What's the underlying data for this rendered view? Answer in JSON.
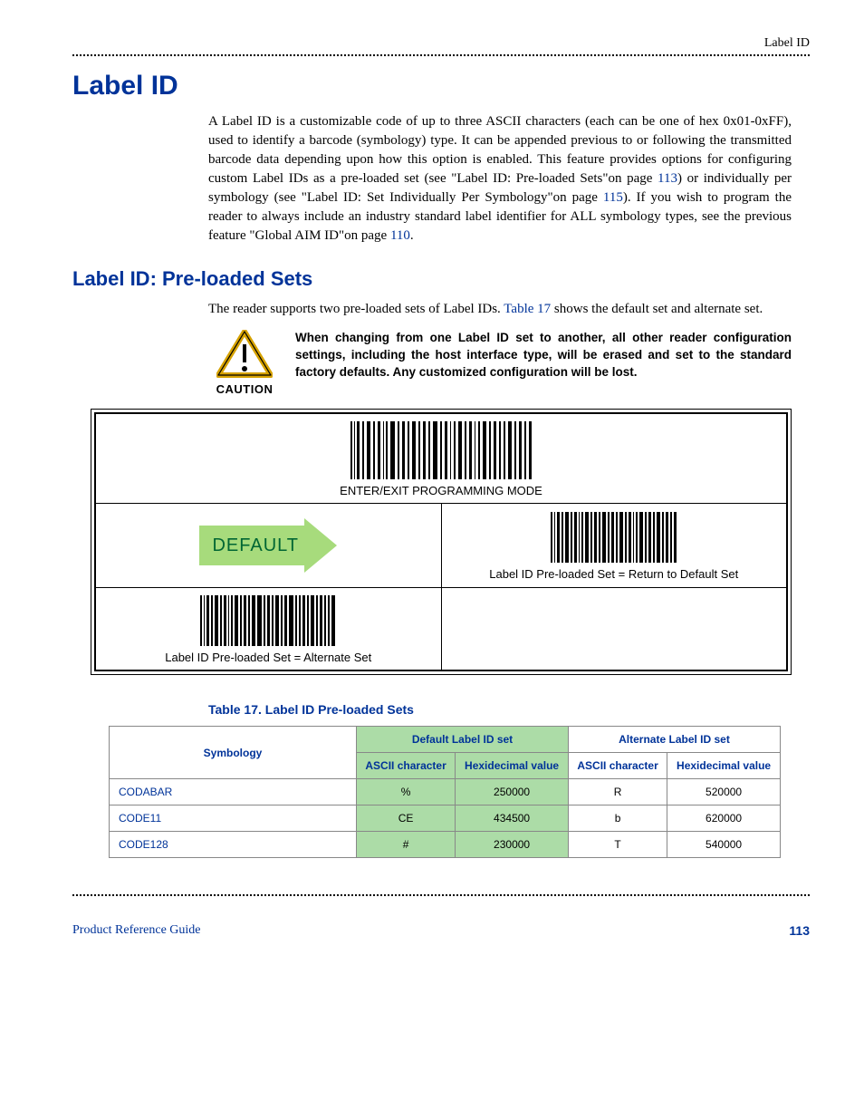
{
  "header": {
    "right": "Label ID"
  },
  "h1": "Label ID",
  "para1_pre": "A Label ID is a customizable code of up to three ASCII characters (each can be one of hex 0x01-0xFF), used to identify a barcode (symbology) type. It can be appended previous to or following the transmitted barcode data depending upon how this option is enabled. This feature provides options for configuring custom Label IDs as a pre-loaded set (see \"Label ID: Pre-loaded Sets\"on page ",
  "link113a": "113",
  "para1_mid": ") or individually per symbology (see \"Label ID: Set Individually Per Symbology\"on page ",
  "link115": "115",
  "para1_mid2": "). If you wish to program the reader to always include an industry standard label identifier for ALL symbology types, see the previous feature \"Global AIM ID\"on page ",
  "link110": "110",
  "para1_end": ".",
  "h2": "Label ID: Pre-loaded Sets",
  "para2_pre": "The reader supports two pre-loaded sets of Label IDs. ",
  "table17link": "Table 17",
  "para2_post": " shows the default set and alternate set.",
  "caution": {
    "label": "CAUTION",
    "text": "When changing from one Label ID set to another, all other reader configuration settings, including the host interface type, will be erased and set to the standard factory defaults. Any customized configuration will be lost."
  },
  "box": {
    "enter_exit": "ENTER/EXIT PROGRAMMING MODE",
    "default_label": "DEFAULT",
    "return_default": "Label ID Pre-loaded Set = Return to Default Set",
    "alternate": "Label ID Pre-loaded Set = Alternate Set"
  },
  "table_title": "Table 17. Label ID Pre-loaded Sets",
  "table": {
    "head": {
      "symbology": "Symbology",
      "default_set": "Default Label ID set",
      "alternate_set": "Alternate Label ID set",
      "ascii": "ASCII character",
      "hex": "Hexidecimal value"
    },
    "rows": [
      {
        "sym": "CODABAR",
        "d_ascii": "%",
        "d_hex": "250000",
        "a_ascii": "R",
        "a_hex": "520000"
      },
      {
        "sym": "CODE11",
        "d_ascii": "CE",
        "d_hex": "434500",
        "a_ascii": "b",
        "a_hex": "620000"
      },
      {
        "sym": "CODE128",
        "d_ascii": "#",
        "d_hex": "230000",
        "a_ascii": "T",
        "a_hex": "540000"
      }
    ]
  },
  "footer": {
    "guide": "Product Reference Guide",
    "page": "113"
  }
}
